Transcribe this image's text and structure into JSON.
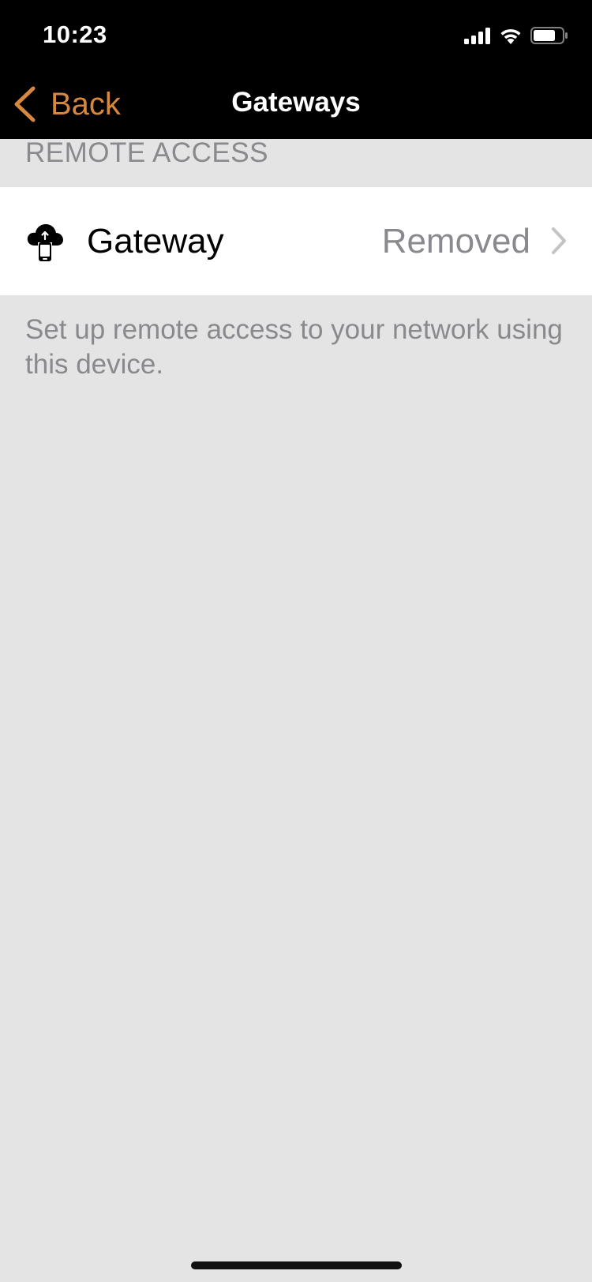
{
  "status_bar": {
    "time": "10:23",
    "icons": [
      "cellular-signal-icon",
      "wifi-icon",
      "battery-icon"
    ]
  },
  "nav": {
    "back_label": "Back",
    "title": "Gateways",
    "accent_color": "#d8883e"
  },
  "section": {
    "header": "REMOTE ACCESS",
    "row": {
      "icon": "cloud-upload-device-icon",
      "label": "Gateway",
      "value": "Removed"
    },
    "footer": "Set up remote access to your network using this device."
  }
}
